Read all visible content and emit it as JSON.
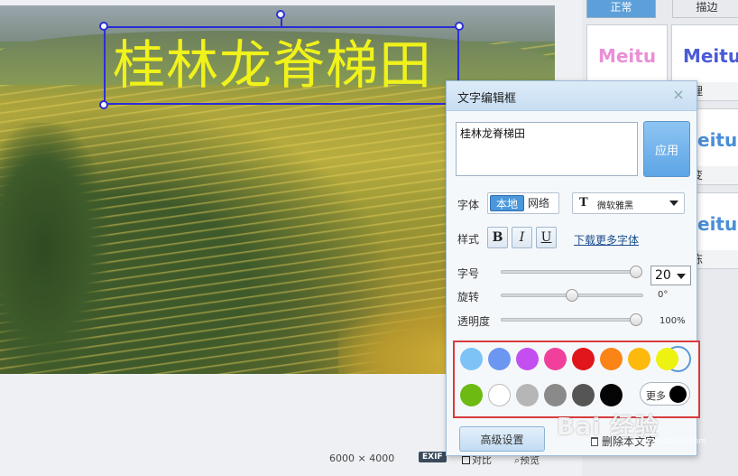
{
  "canvas": {
    "overlay_text": "桂林龙脊梯田",
    "dimensions": "6000 × 4000",
    "exif_badge": "EXIF",
    "compare_label": "对比",
    "preview_label": "预览"
  },
  "gallery": {
    "tabs": [
      {
        "label": "正常",
        "color": "#5d9fd8"
      },
      {
        "label": "描边",
        "color": "#5d9fd8"
      }
    ],
    "cards": [
      {
        "preview": "Meitu",
        "caption": "",
        "color": "#ea8fd6"
      },
      {
        "preview": "Meitu",
        "caption": "纹理",
        "color": "#4a5bd6"
      },
      {
        "preview": "eitu",
        "caption": "渐变",
        "color": "#4a8ed6"
      },
      {
        "preview": "eitu",
        "caption": "果冻",
        "color": "#4a8ed6"
      }
    ]
  },
  "dialog": {
    "title": "文字编辑框",
    "close_icon": "×",
    "text_value": "桂林龙脊梯田",
    "apply_label": "应用",
    "font_label": "字体",
    "font_source": {
      "local": "本地",
      "network": "网络"
    },
    "font_icon": "T",
    "font_name": "微软雅黑",
    "style_label": "样式",
    "style_buttons": [
      "B",
      "I",
      "U"
    ],
    "more_fonts_link": "下载更多字体",
    "size_label": "字号",
    "size_value": "20",
    "rotate_label": "旋转",
    "rotate_value": "0°",
    "opacity_label": "透明度",
    "opacity_value": "100%",
    "slider_levels": {
      "size": 1.0,
      "rotate": 0.5,
      "opacity": 1.0
    },
    "colors": [
      "#7ec3f5",
      "#6b97f0",
      "#c44ff0",
      "#f0409c",
      "#e0161a",
      "#fb8416",
      "#fdb90c",
      "#eef211",
      "#6dba12",
      "#ffffff",
      "#b6b6b6",
      "#8a8a8a",
      "#555555",
      "#050505"
    ],
    "selected_color": "#eef211",
    "more_colors_label": "更多",
    "more_colors_swatch": "#000000",
    "advanced_label": "高级设置",
    "delete_label": "删除本文字"
  },
  "watermark": {
    "logo": "Bai 经验",
    "sub": "jingyan.baidu.com"
  }
}
